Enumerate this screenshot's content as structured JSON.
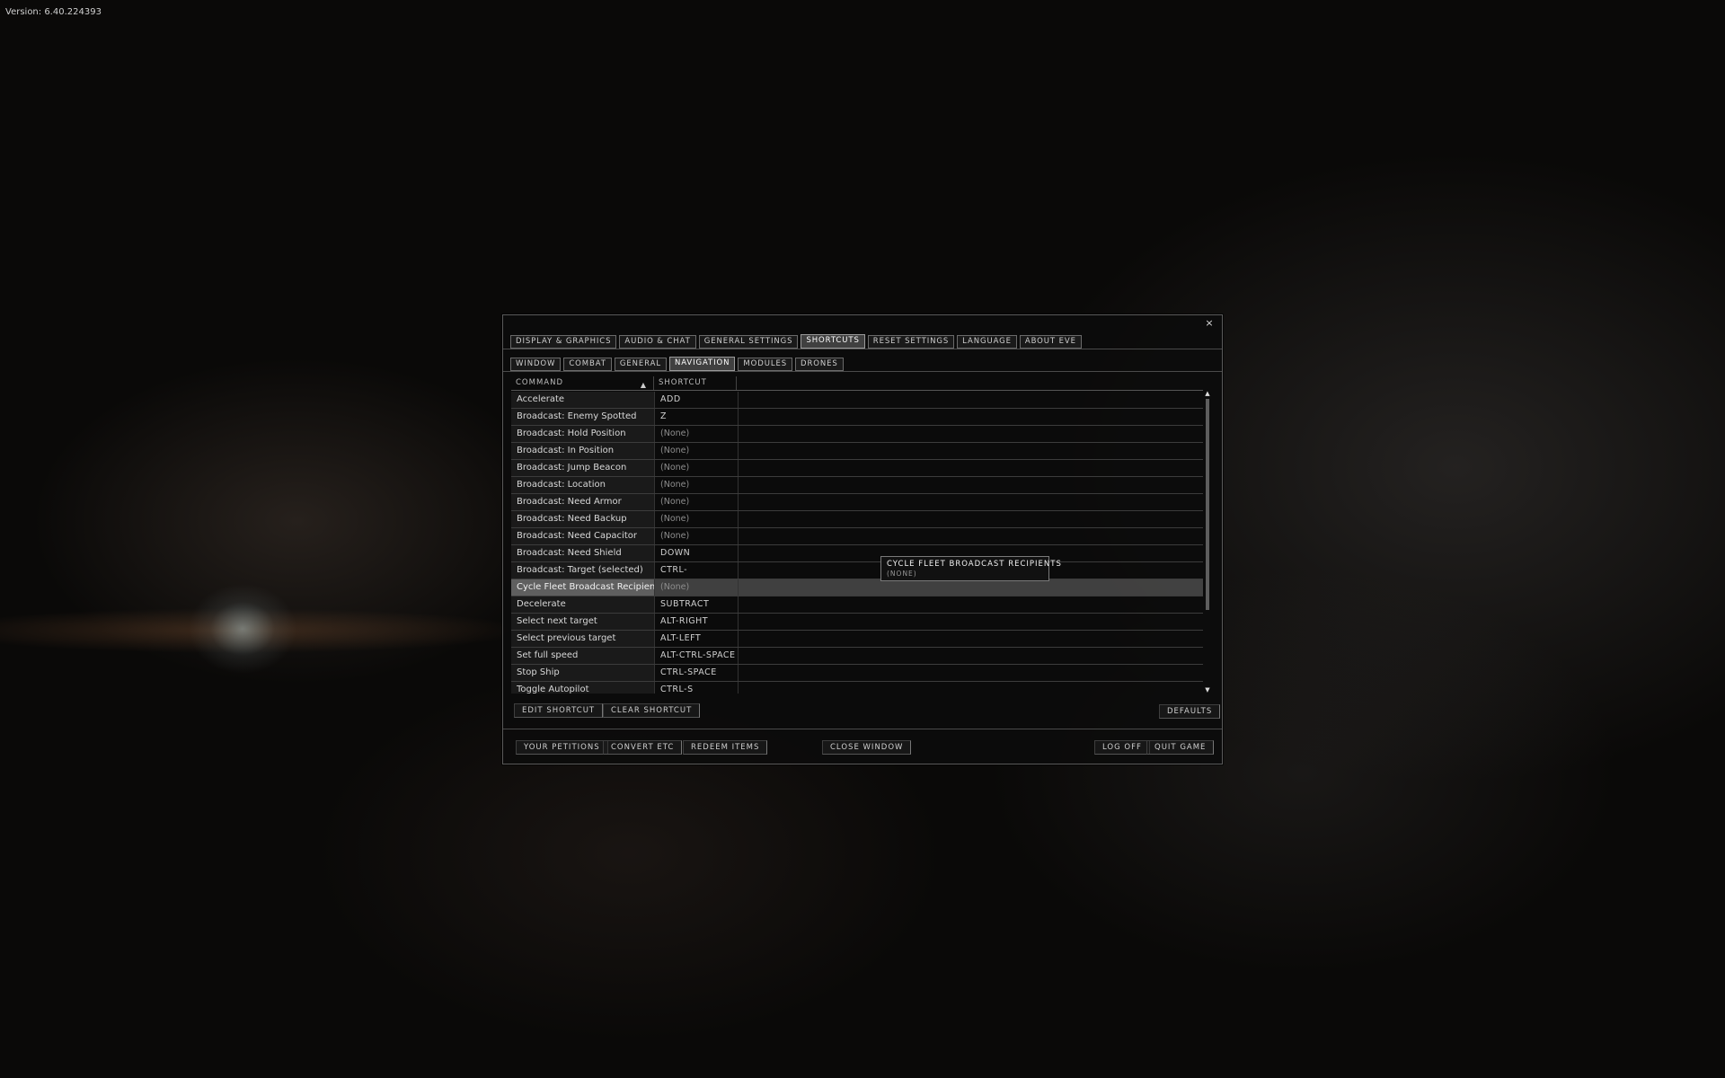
{
  "version_text": "Version: 6.40.224393",
  "window": {
    "close_glyph": "×",
    "main_tabs": [
      {
        "label": "DISPLAY & GRAPHICS",
        "active": false
      },
      {
        "label": "AUDIO & CHAT",
        "active": false
      },
      {
        "label": "GENERAL SETTINGS",
        "active": false
      },
      {
        "label": "SHORTCUTS",
        "active": true
      },
      {
        "label": "RESET SETTINGS",
        "active": false
      },
      {
        "label": "LANGUAGE",
        "active": false
      },
      {
        "label": "ABOUT EVE",
        "active": false
      }
    ],
    "sub_tabs": [
      {
        "label": "WINDOW",
        "active": false
      },
      {
        "label": "COMBAT",
        "active": false
      },
      {
        "label": "GENERAL",
        "active": false
      },
      {
        "label": "NAVIGATION",
        "active": true
      },
      {
        "label": "MODULES",
        "active": false
      },
      {
        "label": "DRONES",
        "active": false
      }
    ],
    "table": {
      "columns": {
        "command": "COMMAND",
        "shortcut": "SHORTCUT"
      },
      "sort_glyph": "▲",
      "rows": [
        {
          "command": "Accelerate",
          "shortcut": "ADD"
        },
        {
          "command": "Broadcast: Enemy Spotted",
          "shortcut": "Z"
        },
        {
          "command": "Broadcast: Hold Position",
          "shortcut": "(None)"
        },
        {
          "command": "Broadcast: In Position",
          "shortcut": "(None)"
        },
        {
          "command": "Broadcast: Jump Beacon",
          "shortcut": "(None)"
        },
        {
          "command": "Broadcast: Location",
          "shortcut": "(None)"
        },
        {
          "command": "Broadcast: Need Armor",
          "shortcut": "(None)"
        },
        {
          "command": "Broadcast: Need Backup",
          "shortcut": "(None)"
        },
        {
          "command": "Broadcast: Need Capacitor",
          "shortcut": "(None)"
        },
        {
          "command": "Broadcast: Need Shield",
          "shortcut": "DOWN"
        },
        {
          "command": "Broadcast: Target (selected)",
          "shortcut": "CTRL-"
        },
        {
          "command": "Cycle Fleet Broadcast Recipients",
          "shortcut": "(None)",
          "selected": true
        },
        {
          "command": "Decelerate",
          "shortcut": "SUBTRACT"
        },
        {
          "command": "Select next target",
          "shortcut": "ALT-RIGHT"
        },
        {
          "command": "Select previous target",
          "shortcut": "ALT-LEFT"
        },
        {
          "command": "Set full speed",
          "shortcut": "ALT-CTRL-SPACE"
        },
        {
          "command": "Stop Ship",
          "shortcut": "CTRL-SPACE"
        },
        {
          "command": "Toggle Autopilot",
          "shortcut": "CTRL-S"
        }
      ],
      "scroll_up_glyph": "▲",
      "scroll_down_glyph": "▼"
    },
    "actions": {
      "edit_shortcut": "EDIT SHORTCUT",
      "clear_shortcut": "CLEAR SHORTCUT",
      "defaults": "DEFAULTS"
    },
    "footer": {
      "your_petitions": "YOUR PETITIONS",
      "convert_etc": "CONVERT ETC",
      "redeem_items": "REDEEM ITEMS",
      "close_window": "CLOSE WINDOW",
      "log_off": "LOG OFF",
      "quit_game": "QUIT GAME"
    }
  },
  "tooltip": {
    "title": "CYCLE FLEET BROADCAST RECIPIENTS",
    "value": "(NONE)"
  }
}
